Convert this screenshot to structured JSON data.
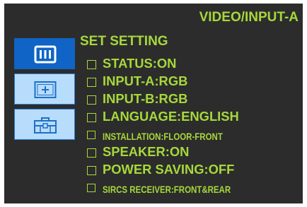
{
  "osd": {
    "source_title": "VIDEO/INPUT-A",
    "menu_title": "SET SETTING",
    "icons": [
      {
        "name": "bars-icon",
        "selected": true
      },
      {
        "name": "plus-box-icon",
        "selected": false
      },
      {
        "name": "toolbox-icon",
        "selected": false
      }
    ],
    "settings": [
      {
        "label": "STATUS:ON",
        "size": "large"
      },
      {
        "label": "INPUT-A:RGB",
        "size": "large"
      },
      {
        "label": "INPUT-B:RGB",
        "size": "large"
      },
      {
        "label": "LANGUAGE:ENGLISH",
        "size": "large"
      },
      {
        "label": "INSTALLATION:FLOOR-FRONT",
        "size": "small"
      },
      {
        "label": "SPEAKER:ON",
        "size": "large"
      },
      {
        "label": "POWER SAVING:OFF",
        "size": "large"
      },
      {
        "label": "SIRCS RECEIVER:FRONT&REAR",
        "size": "small"
      }
    ],
    "colors": {
      "background": "#2c2c2c",
      "text": "#a6d83b",
      "icon_selected": "#0f64c5",
      "icon_normal": "#b8dcfb",
      "icon_border": "#2b7ed2"
    }
  }
}
